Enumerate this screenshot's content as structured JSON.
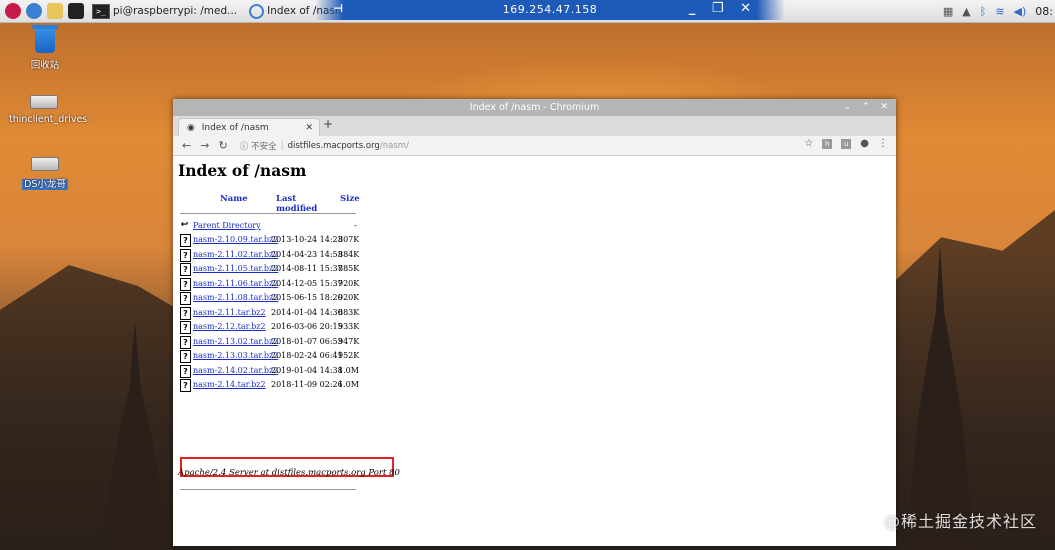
{
  "taskbar": {
    "terminal_task": "pi@raspberrypi: /med...",
    "browser_task": "Index of /nasm - Chr...",
    "rdp_ip": "169.254.47.158",
    "clock": "08:"
  },
  "desktop": {
    "icons": [
      {
        "label": "回收站"
      },
      {
        "label": "thinclient_drives"
      },
      {
        "label": "DS小龙哥"
      }
    ]
  },
  "window": {
    "title": "Index of /nasm - Chromium",
    "tab_label": "Index of /nasm",
    "new_tab": "+",
    "security_label": "不安全",
    "url_host": "distfiles.macports.org",
    "url_path": "/nasm/"
  },
  "page": {
    "heading": "Index of /nasm",
    "columns": {
      "name": "Name",
      "modified": "Last modified",
      "size": "Size"
    },
    "parent": {
      "name": "Parent Directory",
      "size": "-"
    },
    "files": [
      {
        "name": "nasm-2.10.09.tar.bz2",
        "modified": "2013-10-24 14:23",
        "size": "807K"
      },
      {
        "name": "nasm-2.11.02.tar.bz2",
        "modified": "2014-04-23 14:53",
        "size": "884K"
      },
      {
        "name": "nasm-2.11.05.tar.bz2",
        "modified": "2014-08-11 15:37",
        "size": "885K"
      },
      {
        "name": "nasm-2.11.06.tar.bz2",
        "modified": "2014-12-05 15:37",
        "size": "920K"
      },
      {
        "name": "nasm-2.11.08.tar.bz2",
        "modified": "2015-06-15 18:20",
        "size": "920K"
      },
      {
        "name": "nasm-2.11.tar.bz2",
        "modified": "2014-01-04 14:30",
        "size": "883K"
      },
      {
        "name": "nasm-2.12.tar.bz2",
        "modified": "2016-03-06 20:15",
        "size": "933K"
      },
      {
        "name": "nasm-2.13.02.tar.bz2",
        "modified": "2018-01-07 06:53",
        "size": "947K"
      },
      {
        "name": "nasm-2.13.03.tar.bz2",
        "modified": "2018-02-24 06:41",
        "size": "952K"
      },
      {
        "name": "nasm-2.14.02.tar.bz2",
        "modified": "2019-01-04 14:38",
        "size": "1.0M"
      },
      {
        "name": "nasm-2.14.tar.bz2",
        "modified": "2018-11-09 02:26",
        "size": "1.0M"
      }
    ],
    "footer": "Apache/2.4 Server at distfiles.macports.org Port 80"
  },
  "watermark": "@稀土掘金技术社区",
  "colors": {
    "link": "#1a2ec8",
    "highlight": "#e02424",
    "rdp_bar": "#1e5bb8"
  }
}
